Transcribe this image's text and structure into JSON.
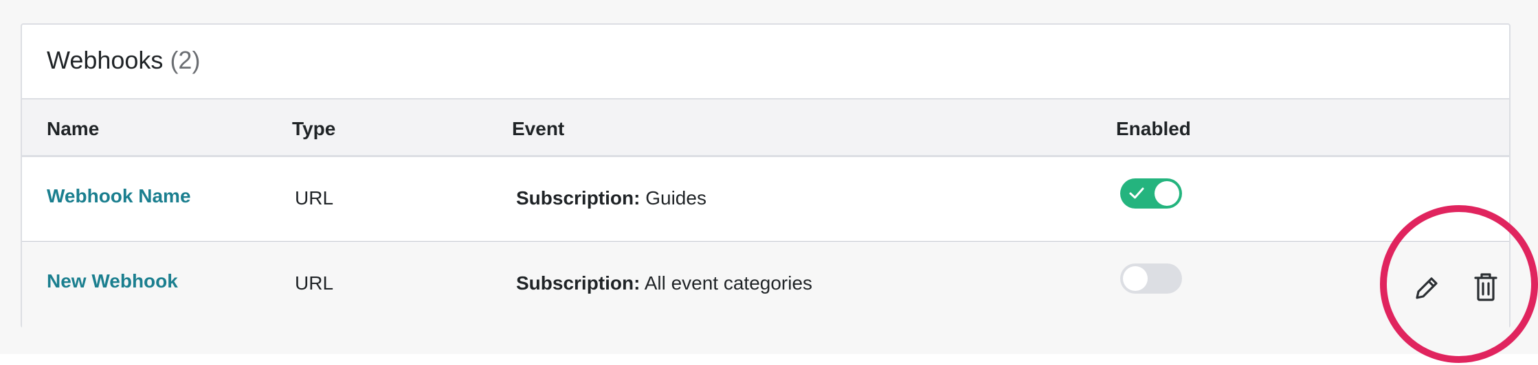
{
  "panel": {
    "title": "Webhooks",
    "count": "(2)"
  },
  "table": {
    "columns": {
      "name": "Name",
      "type": "Type",
      "event": "Event",
      "enabled": "Enabled"
    },
    "rows": [
      {
        "name": "Webhook Name",
        "type": "URL",
        "event_label": "Subscription:",
        "event_value": "Guides",
        "enabled": true
      },
      {
        "name": "New Webhook",
        "type": "URL",
        "event_label": "Subscription:",
        "event_value": "All event categories",
        "enabled": false
      }
    ]
  },
  "row_actions": {
    "edit_icon": "pencil-icon",
    "delete_icon": "trash-icon"
  },
  "colors": {
    "link": "#1b7f8f",
    "toggle_on": "#24b47e",
    "toggle_off": "#dcdee3",
    "highlight": "#e0245e"
  }
}
